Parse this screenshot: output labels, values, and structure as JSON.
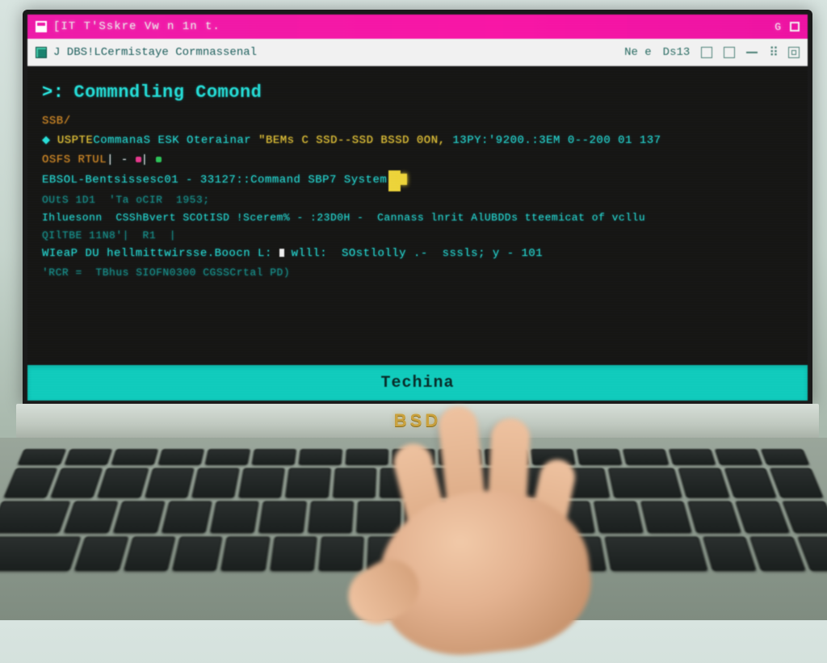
{
  "titlebar": {
    "text": "[IT T'Sskre Vw n 1n t."
  },
  "toolbar": {
    "left_label": "J  DBS!LCermistaye Cormnassenal",
    "menu_a": "Ne e",
    "menu_b": "Ds13"
  },
  "header": {
    "chevron": ">:",
    "title": "Commndling Comond"
  },
  "lines": {
    "l1a": "SSB/",
    "l2_pre": "◆ ",
    "l2a": "USPTE",
    "l2b": "CommanaS ESK Oterainar ",
    "l2c": "\"BEMs C SSD--SSD BSSD 0ON,",
    "l2d": " 13PY:'9200.:3EM 0--200 01 137",
    "l3a": "OSFS RTUL",
    "l3b": "| - ",
    "l3c": "| ",
    "l4a": "EBSOL-Bentsissesc01 - 33127::Command SBP7 System",
    "l4_cursor": " ",
    "l5": "OUtS 1D1  'Ta oCIR  1953;",
    "l6": "Ihluesonn  CSShBvert SCOtISD !Scerem% - :23D0H -  Cannass lnrit AlUBDDs tteemicat of vcllu",
    "l7": "QIlTBE 11N8'|  R1  |",
    "l8_a": "WIeaP DU hellmittwirsse.Boocn L: ",
    "l8_b": " wlll:  SOstlolly .-  sssls; y - 101",
    "l9": "'RCR =  TBhus SIOFN0300 CGSSCrtal PD)"
  },
  "statusbar": {
    "label": "Techina"
  },
  "brand": "BSD"
}
